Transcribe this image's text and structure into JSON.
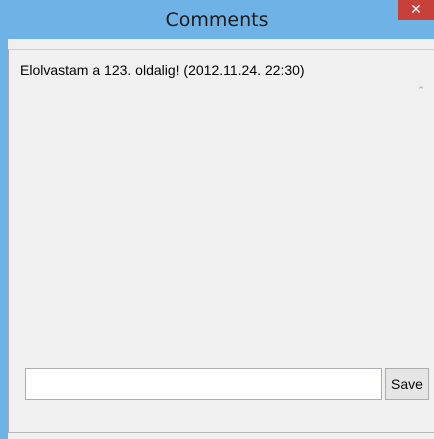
{
  "window": {
    "title": "Comments",
    "close_glyph": "✕"
  },
  "comments": {
    "items": [
      {
        "text": "Elolvastam a 123. oldalig! (2012.11.24. 22:30)"
      }
    ]
  },
  "scrollbar": {
    "up_glyph": "⌃",
    "down_glyph": "⌄"
  },
  "input": {
    "value": "",
    "placeholder": ""
  },
  "actions": {
    "save_label": "Save"
  },
  "colors": {
    "titlebar": "#6fb2e6",
    "close_button": "#c7403a",
    "client_background": "#f0f0f0"
  }
}
